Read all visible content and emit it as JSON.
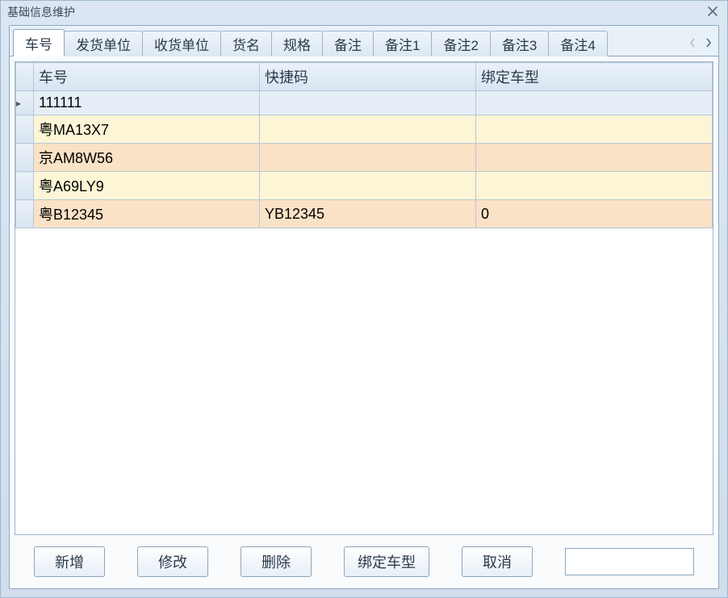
{
  "window": {
    "title": "基础信息维护"
  },
  "tabs": [
    {
      "label": "车号",
      "active": true
    },
    {
      "label": "发货单位",
      "active": false
    },
    {
      "label": "收货单位",
      "active": false
    },
    {
      "label": "货名",
      "active": false
    },
    {
      "label": "规格",
      "active": false
    },
    {
      "label": "备注",
      "active": false
    },
    {
      "label": "备注1",
      "active": false
    },
    {
      "label": "备注2",
      "active": false
    },
    {
      "label": "备注3",
      "active": false
    },
    {
      "label": "备注4",
      "active": false
    }
  ],
  "grid": {
    "columns": [
      "车号",
      "快捷码",
      "绑定车型"
    ],
    "rows": [
      {
        "selected": true,
        "cells": [
          "111111",
          "",
          ""
        ]
      },
      {
        "selected": false,
        "cells": [
          "粤MA13X7",
          "",
          ""
        ]
      },
      {
        "selected": false,
        "cells": [
          "京AM8W56",
          "",
          ""
        ]
      },
      {
        "selected": false,
        "cells": [
          "粤A69LY9",
          "",
          ""
        ]
      },
      {
        "selected": false,
        "cells": [
          "粤B12345",
          "YB12345",
          "0"
        ]
      }
    ]
  },
  "buttons": {
    "add": "新增",
    "edit": "修改",
    "delete": "删除",
    "bind": "绑定车型",
    "cancel": "取消"
  },
  "search": {
    "value": "",
    "placeholder": ""
  },
  "icons": {
    "close": "close-icon",
    "arrow_left": "chevron-left-icon",
    "arrow_right": "chevron-right-icon",
    "row_pointer": "▸"
  }
}
